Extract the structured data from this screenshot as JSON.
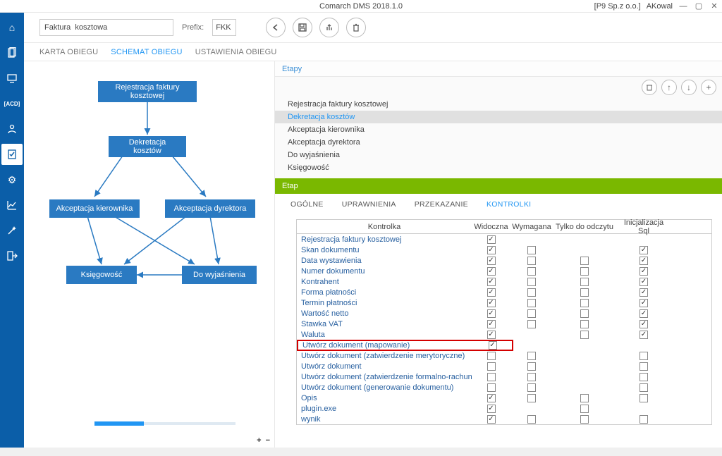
{
  "app_title": "Comarch DMS 2018.1.0",
  "title_right": {
    "company": "[P9 Sp.z o.o.]",
    "user": "AKowal"
  },
  "header": {
    "name_value": "Faktura  kosztowa",
    "prefix_label": "Prefix:",
    "prefix_value": "FKK"
  },
  "tabs": {
    "card": "KARTA OBIEGU",
    "schema": "SCHEMAT OBIEGU",
    "settings": "USTAWIENIA OBIEGU"
  },
  "workflow_nodes": {
    "n1": "Rejestracja faktury kosztowej",
    "n2": "Dekretacja kosztów",
    "n3": "Akceptacja kierownika",
    "n4": "Akceptacja dyrektora",
    "n5": "Księgowość",
    "n6": "Do wyjaśnienia"
  },
  "zoom": {
    "plus": "+",
    "minus": "−"
  },
  "right_panel": {
    "stages_label": "Etapy",
    "stages": [
      "Rejestracja faktury kosztowej",
      "Dekretacja kosztów",
      "Akceptacja kierownika",
      "Akceptacja dyrektora",
      "Do wyjaśnienia",
      "Księgowość"
    ],
    "selected_index": 1,
    "etap_label": "Etap",
    "etap_tabs": {
      "general": "OGÓLNE",
      "perm": "UPRAWNIENIA",
      "transfer": "PRZEKAZANIE",
      "controls": "KONTROLKI"
    },
    "grid_headers": {
      "control": "Kontrolka",
      "visible": "Widoczna",
      "required": "Wymagana",
      "readonly": "Tylko do odczytu",
      "initsql": "Inicjalizacja Sql"
    },
    "rows": [
      {
        "name": "Rejestracja faktury kosztowej",
        "v": true,
        "r": null,
        "ro": null,
        "sql": null
      },
      {
        "name": "Skan dokumentu",
        "v": true,
        "r": false,
        "ro": null,
        "sql": true
      },
      {
        "name": "Data wystawienia",
        "v": true,
        "r": false,
        "ro": false,
        "sql": true
      },
      {
        "name": "Numer dokumentu",
        "v": true,
        "r": false,
        "ro": false,
        "sql": true
      },
      {
        "name": "Kontrahent",
        "v": true,
        "r": false,
        "ro": false,
        "sql": true
      },
      {
        "name": "Forma płatności",
        "v": true,
        "r": false,
        "ro": false,
        "sql": true
      },
      {
        "name": "Termin płatności",
        "v": true,
        "r": false,
        "ro": false,
        "sql": true
      },
      {
        "name": "Wartość netto",
        "v": true,
        "r": false,
        "ro": false,
        "sql": true
      },
      {
        "name": "Stawka VAT",
        "v": true,
        "r": false,
        "ro": false,
        "sql": true
      },
      {
        "name": "Waluta",
        "v": true,
        "r": null,
        "ro": false,
        "sql": true
      },
      {
        "name": "Utwórz dokument (mapowanie)",
        "v": true,
        "r": null,
        "ro": null,
        "sql": null,
        "highlight": true
      },
      {
        "name": "Utwórz dokument (zatwierdzenie merytoryczne)",
        "v": false,
        "r": false,
        "ro": null,
        "sql": false
      },
      {
        "name": "Utwórz dokument",
        "v": false,
        "r": false,
        "ro": null,
        "sql": false
      },
      {
        "name": "Utwórz dokument (zatwierdzenie formalno-rachunkowe)",
        "v": false,
        "r": false,
        "ro": null,
        "sql": false
      },
      {
        "name": "Utwórz dokument (generowanie dokumentu)",
        "v": false,
        "r": false,
        "ro": null,
        "sql": false
      },
      {
        "name": "Opis",
        "v": true,
        "r": false,
        "ro": false,
        "sql": false
      },
      {
        "name": "plugin.exe",
        "v": true,
        "r": null,
        "ro": false,
        "sql": null
      },
      {
        "name": "wynik",
        "v": true,
        "r": false,
        "ro": false,
        "sql": false
      }
    ]
  }
}
